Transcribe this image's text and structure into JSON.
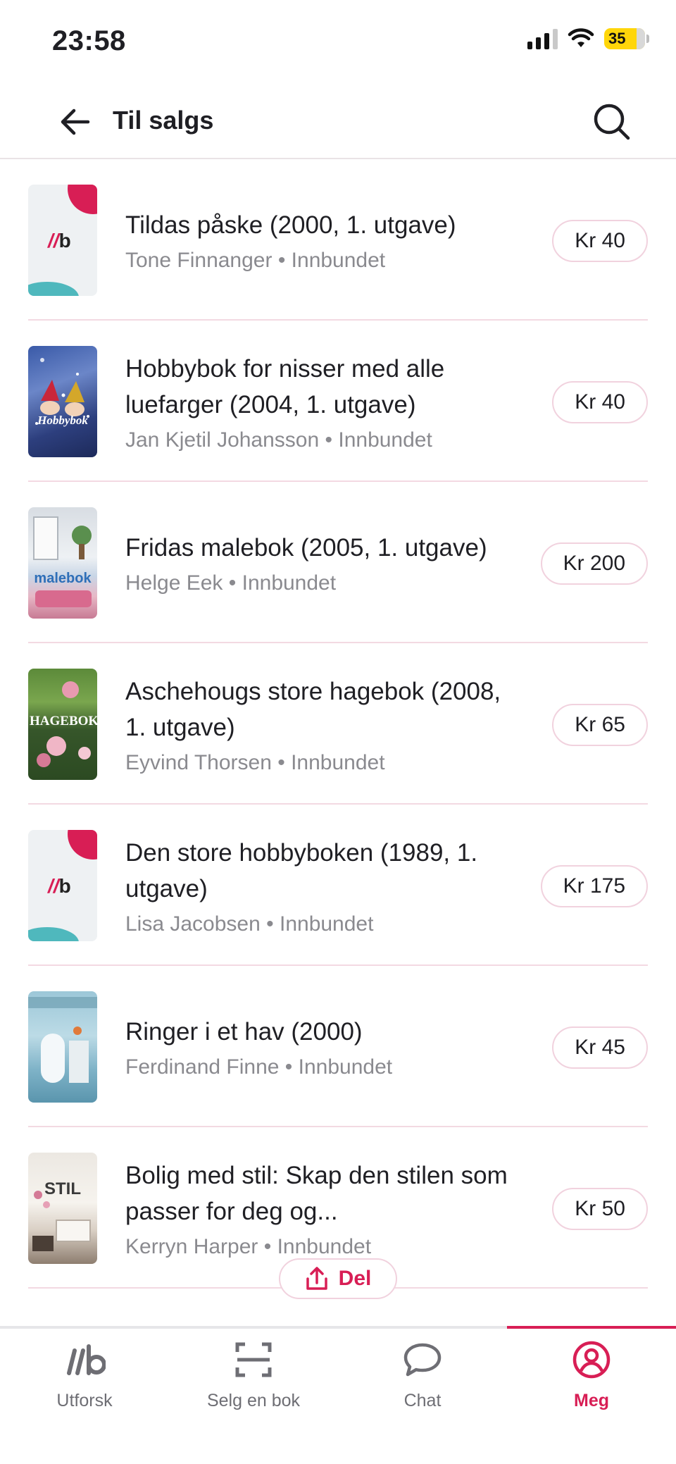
{
  "status_bar": {
    "time": "23:58",
    "battery": "35"
  },
  "header": {
    "back_icon": "arrow-left-icon",
    "title": "Til salgs",
    "search_icon": "search-icon"
  },
  "books": [
    {
      "title": "Tildas påske (2000, 1. utgave)",
      "author": "Tone Finnanger",
      "binding": "Innbundet",
      "price": "Kr 40",
      "cover": "placeholder"
    },
    {
      "title": "Hobbybok for nisser med alle luefarger (2004, 1. utgave)",
      "author": "Jan Kjetil Johansson",
      "binding": "Innbundet",
      "price": "Kr 40",
      "cover": "photo"
    },
    {
      "title": "Fridas malebok (2005, 1. utgave)",
      "author": "Helge Eek",
      "binding": "Innbundet",
      "price": "Kr 200",
      "cover": "photo"
    },
    {
      "title": "Aschehougs store hagebok (2008, 1. utgave)",
      "author": "Eyvind Thorsen",
      "binding": "Innbundet",
      "price": "Kr 65",
      "cover": "photo"
    },
    {
      "title": "Den store hobbyboken (1989, 1. utgave)",
      "author": "Lisa Jacobsen",
      "binding": "Innbundet",
      "price": "Kr 175",
      "cover": "placeholder"
    },
    {
      "title": "Ringer i et hav (2000)",
      "author": "Ferdinand Finne",
      "binding": "Innbundet",
      "price": "Kr 45",
      "cover": "photo"
    },
    {
      "title": "Bolig med stil: Skap den stilen som passer for deg og...",
      "author": "Kerryn Harper",
      "binding": "Innbundet",
      "price": "Kr 50",
      "cover": "photo"
    }
  ],
  "cover_labels": {
    "hobbybok": "Hobbybok",
    "malebok": "malebok",
    "hagebok": "HAGEBOK",
    "stil": "STIL"
  },
  "share": {
    "label": "Del",
    "icon": "share-icon"
  },
  "bottom_nav": [
    {
      "label": "Utforsk",
      "icon": "lb-logo-icon",
      "active": false
    },
    {
      "label": "Selg en bok",
      "icon": "scan-icon",
      "active": false
    },
    {
      "label": "Chat",
      "icon": "chat-bubble-icon",
      "active": false
    },
    {
      "label": "Meg",
      "icon": "profile-icon",
      "active": true
    }
  ],
  "colors": {
    "accent": "#d81e55",
    "divider": "#f3d9e2",
    "muted_text": "#8a8a8f"
  }
}
